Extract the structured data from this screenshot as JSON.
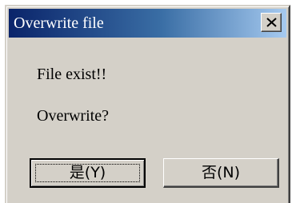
{
  "window": {
    "title": "Overwrite file",
    "close_icon": "close-icon"
  },
  "message": {
    "line1": "File exist!!",
    "line2": "Overwrite?"
  },
  "buttons": {
    "yes_label": "是(Y)",
    "no_label": "否(N)"
  }
}
